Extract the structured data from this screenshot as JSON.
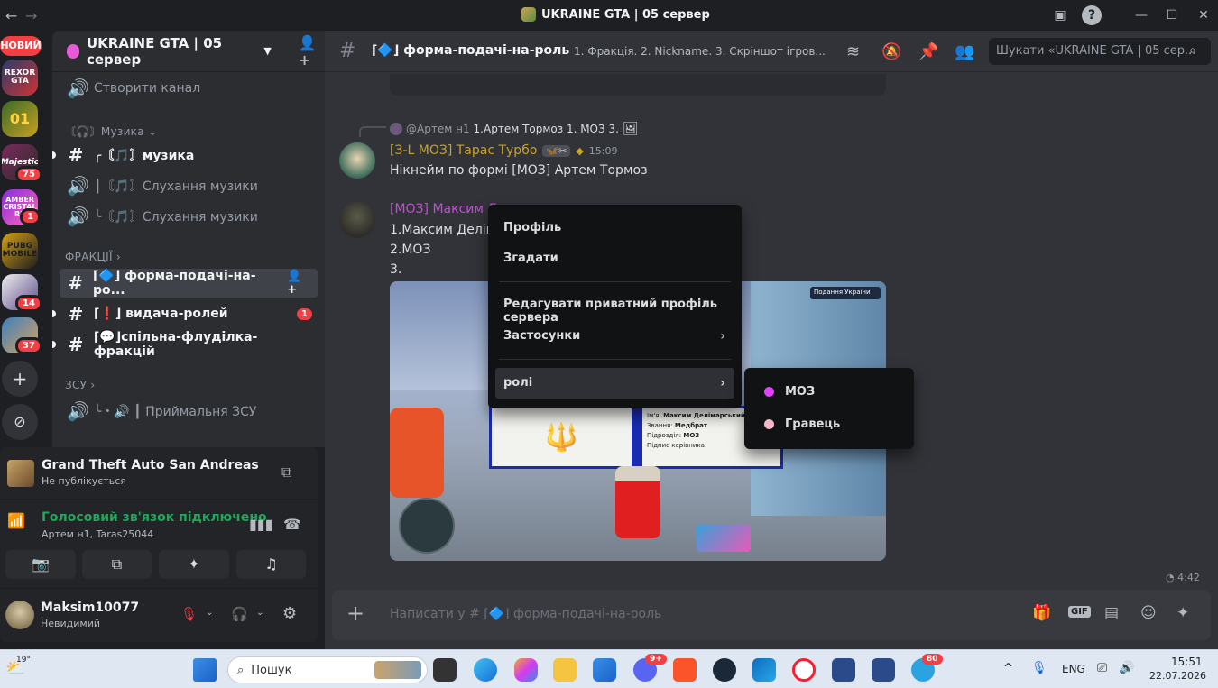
{
  "window": {
    "title": "UKRAINE GTA | 05 сервер",
    "back": "←",
    "forward": "→"
  },
  "servers": {
    "new_label": "НОВИЙ",
    "items": [
      {
        "name": "REXOR GTA",
        "badge": ""
      },
      {
        "name": "01",
        "badge": ""
      },
      {
        "name": "Majestic",
        "badge": "75"
      },
      {
        "name": "AMBER CRISTAL RP",
        "badge": "1"
      },
      {
        "name": "PUBG MOBILE",
        "badge": ""
      },
      {
        "name": "",
        "badge": "14"
      },
      {
        "name": "",
        "badge": "37"
      }
    ]
  },
  "sidebar": {
    "server_name": "UKRAINE GTA | 05 сервер",
    "create_channel": "Створити канал",
    "cat_music": "〘🎧〙Музика",
    "ch_music": "╭〘🎵〙музика",
    "ch_listen1": "┃〘🎵〙Слухання музики",
    "ch_listen2": "╰〘🎵〙Слухання музики",
    "cat_factions": "ФРАКЦІЇ",
    "ch_form": "⌈🔷⌋ форма-подачі-на-ро...",
    "ch_roles": "⌈❗⌋ видача-ролей",
    "ch_roles_badge": "1",
    "ch_flood": "⌈💬⌋спільна-флуділка-фракцій",
    "cat_zsu": "ЗСУ",
    "ch_zsu": "╰・🔊 ┃ Приймальня ЗСУ"
  },
  "activity": {
    "game": "Grand Theft Auto San Andreas",
    "status": "Не публікується"
  },
  "voice": {
    "status": "Голосовий зв'язок підключено",
    "users": "Артем н1, Taras25044"
  },
  "user": {
    "name": "Maksim10077",
    "status": "Невидимий"
  },
  "channel": {
    "name": "⌈🔷⌋ форма-подачі-на-роль",
    "topic": "1. Фракція. 2. Nickname. 3. Скріншот ігров...",
    "search_placeholder": "Шукати «UKRAINE GTA | 05 сер..."
  },
  "messages": {
    "reply_to": "@Артем н1",
    "reply_text": "1.Артем Тормоз 1. МОЗ   3.",
    "m1_author": "[З-L МОЗ] Тарас Турбо",
    "m1_time": "15:09",
    "m1_text": "Нікнейм по формі [МОЗ] Артем Тормоз",
    "m2_author": "[МОЗ] Максим Д",
    "m2_line1": "1.Максим Делім",
    "m2_line2": "2.МОЗ",
    "m2_line3": "3.",
    "duration": "4:42"
  },
  "game_card": {
    "name_label": "Ім'я:",
    "name_value": "Максим Делімарський",
    "rank_label": "Звання:",
    "rank_value": "Медбрат",
    "unit_label": "Підрозділ:",
    "unit_value": "МОЗ",
    "sign_label": "Підпис керівника:",
    "bar_label": "Подання України"
  },
  "input": {
    "placeholder": "Написати у # ⌈🔷⌋ форма-подачі-на-роль"
  },
  "context_menu": {
    "profile": "Профіль",
    "mention": "Згадати",
    "edit_profile": "Редагувати приватний профіль сервера",
    "apps": "Застосунки",
    "roles": "ролі"
  },
  "roles": [
    {
      "name": "МОЗ",
      "color": "#e040fb"
    },
    {
      "name": "Гравець",
      "color": "#f5b7c8"
    }
  ],
  "taskbar": {
    "weather": "19°",
    "search": "Пошук",
    "lang": "ENG",
    "time": "15:51",
    "date": "22.07.2026",
    "discord_badge": "9+",
    "telegram_badge": "80"
  },
  "colors": {
    "accent": "#5865f2",
    "voice_green": "#23a55a",
    "mention_red": "#f23f43"
  }
}
